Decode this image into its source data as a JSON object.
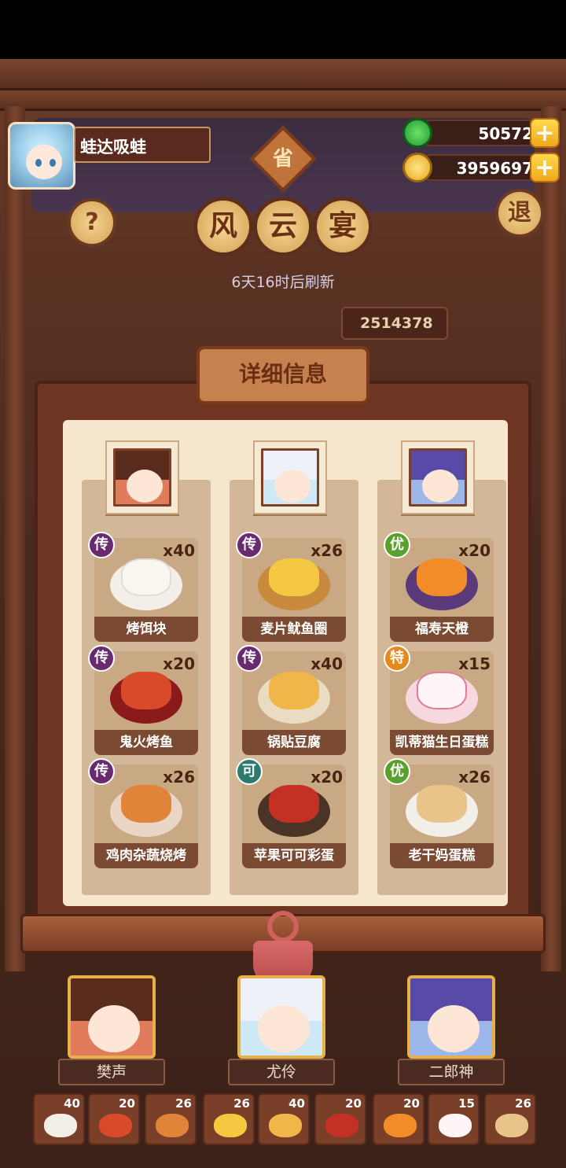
{
  "player": {
    "name": "蛙达吸蛙"
  },
  "currency": {
    "jade": "50572",
    "coins": "3959697",
    "plus_symbol": "+"
  },
  "buttons": {
    "help_label": "?",
    "exit_label": "退"
  },
  "event": {
    "badge": "省",
    "title_chars": [
      "风",
      "云",
      "宴"
    ],
    "refresh_text": "6天16时后刷新",
    "score": "2514378"
  },
  "panel": {
    "title": "详细信息",
    "columns": [
      {
        "dishes": [
          {
            "badge": "传",
            "count": "x40",
            "name": "烤饵块"
          },
          {
            "badge": "传",
            "count": "x20",
            "name": "鬼火烤鱼"
          },
          {
            "badge": "传",
            "count": "x26",
            "name": "鸡肉杂蔬烧烤"
          }
        ]
      },
      {
        "dishes": [
          {
            "badge": "传",
            "count": "x26",
            "name": "麦片鱿鱼圈"
          },
          {
            "badge": "传",
            "count": "x40",
            "name": "锅贴豆腐"
          },
          {
            "badge": "可",
            "count": "x20",
            "name": "苹果可可彩蛋"
          }
        ]
      },
      {
        "dishes": [
          {
            "badge": "优",
            "count": "x20",
            "name": "福寿天橙"
          },
          {
            "badge": "特",
            "count": "x15",
            "name": "凯蒂猫生日蛋糕"
          },
          {
            "badge": "优",
            "count": "x26",
            "name": "老干妈蛋糕"
          }
        ]
      }
    ]
  },
  "chefs": [
    {
      "name": "樊声"
    },
    {
      "name": "尤伶"
    },
    {
      "name": "二郎神"
    }
  ],
  "dish_slots": [
    {
      "count": "40"
    },
    {
      "count": "20"
    },
    {
      "count": "26"
    },
    {
      "count": "26"
    },
    {
      "count": "40"
    },
    {
      "count": "20"
    },
    {
      "count": "20"
    },
    {
      "count": "15"
    },
    {
      "count": "26"
    }
  ],
  "colors": {
    "badge_chuan": "#6a2a6e",
    "badge_you": "#5aa02c",
    "badge_te": "#e38a1e",
    "badge_ke": "#2f7a6e"
  }
}
